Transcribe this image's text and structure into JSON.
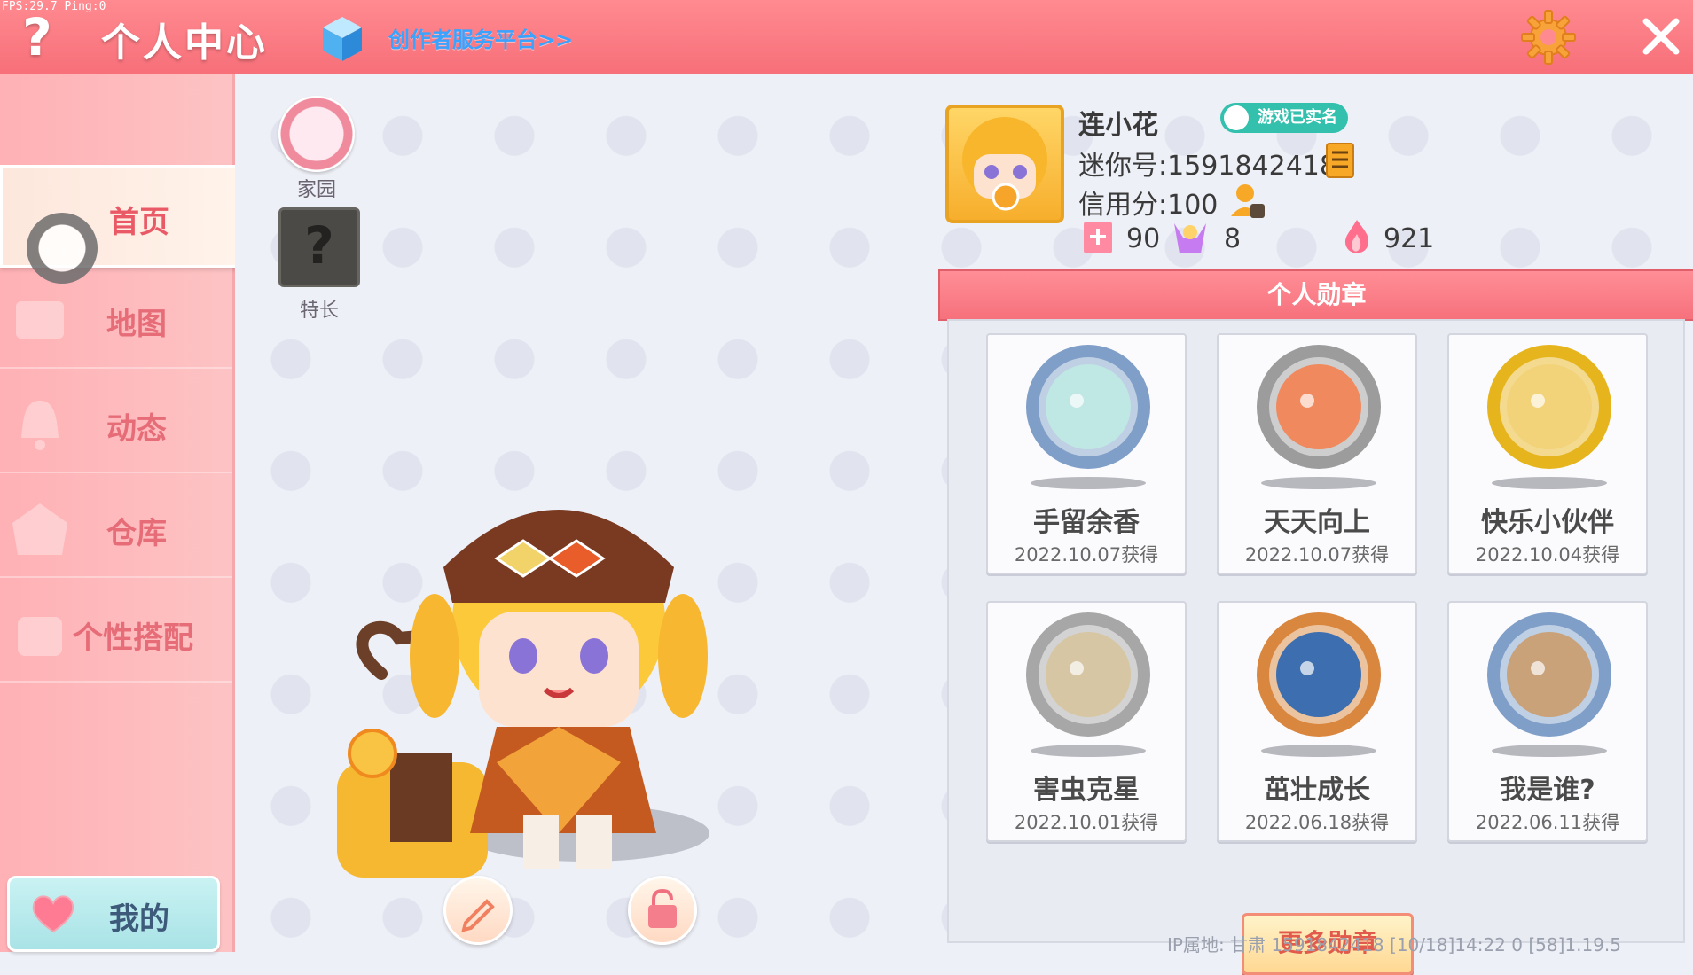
{
  "debug": {
    "fps_text": "FPS:29.7  Ping:0"
  },
  "header": {
    "help_label": "?",
    "title": "个人中心",
    "creator_link": "创作者服务平台>>"
  },
  "sidebar": {
    "items": [
      {
        "label": "首页",
        "active": true
      },
      {
        "label": "地图"
      },
      {
        "label": "动态"
      },
      {
        "label": "仓库"
      },
      {
        "label": "个性搭配"
      }
    ],
    "mine_label": "我的"
  },
  "quick": {
    "home_label": "家园",
    "skill_label": "特长",
    "skill_glyph": "?"
  },
  "profile": {
    "nickname": "连小花",
    "verified_badge": "游戏已实名",
    "mini_id": "迷你号:1591842418",
    "credit": "信用分:100",
    "stats": [
      {
        "icon": "flag-icon",
        "value": "90"
      },
      {
        "icon": "cheer-icon",
        "value": "8"
      },
      {
        "icon": "flame-icon",
        "value": "921"
      }
    ]
  },
  "medals": {
    "header": "个人勋章",
    "items": [
      {
        "name": "手留余香",
        "date": "2022.10.07获得",
        "ring": "#7f9ec8",
        "inner": "#bfe7e3"
      },
      {
        "name": "天天向上",
        "date": "2022.10.07获得",
        "ring": "#9c9c9c",
        "inner": "#f08a5e"
      },
      {
        "name": "快乐小伙伴",
        "date": "2022.10.04获得",
        "ring": "#e6b51e",
        "inner": "#f3d37a"
      },
      {
        "name": "害虫克星",
        "date": "2022.10.01获得",
        "ring": "#a7a7a7",
        "inner": "#d7c6a3"
      },
      {
        "name": "茁壮成长",
        "date": "2022.06.18获得",
        "ring": "#d9863e",
        "inner": "#3d6fb0"
      },
      {
        "name": "我是谁?",
        "date": "2022.06.11获得",
        "ring": "#7f9ec8",
        "inner": "#c9a27a"
      }
    ],
    "more_label": "更多勋章"
  },
  "footer": {
    "info": "IP属地: 甘肃   1591842418  [10/18]14:22 0  [58]1.19.5"
  },
  "colors": {
    "accent": "#f76f79",
    "sidebar": "#ffb1b5",
    "link": "#3aa2ff"
  }
}
